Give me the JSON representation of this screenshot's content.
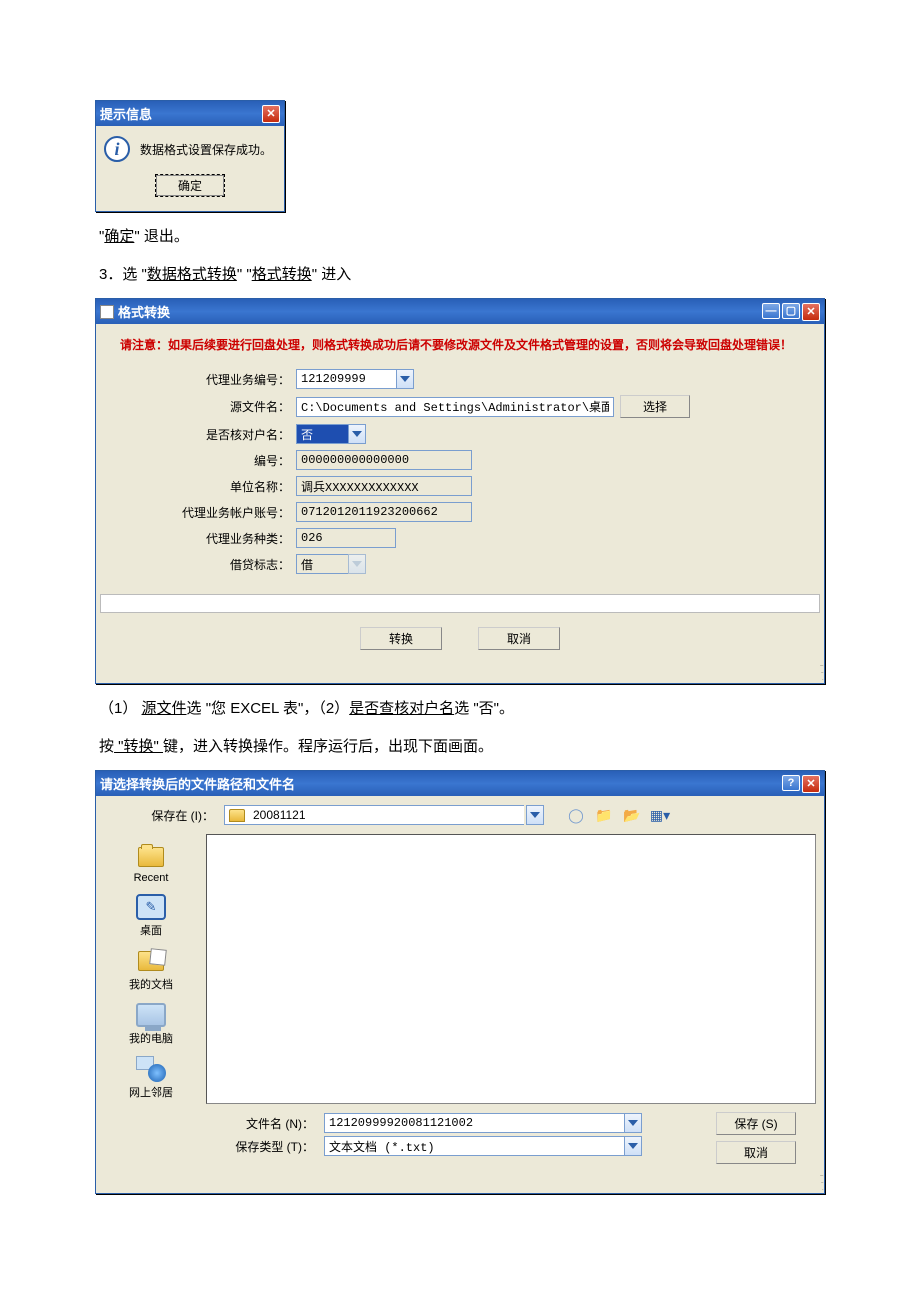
{
  "info_dialog": {
    "title": "提示信息",
    "message": "数据格式设置保存成功。",
    "ok_label": "确定"
  },
  "prose1": {
    "pre": "\"",
    "link": "确定",
    "post": "\" 退出。"
  },
  "step3": {
    "prefix": "3．选 \"",
    "link1": "数据格式转换",
    "mid": "\" \"",
    "link2": "格式转换",
    "suffix": "\" 进入"
  },
  "format_window": {
    "title": "格式转换",
    "notice": "请注意：如果后续要进行回盘处理，则格式转换成功后请不要修改源文件及文件格式管理的设置，否则将会导致回盘处理错误！",
    "fields": {
      "biz_no_label": "代理业务编号：",
      "biz_no": "121209999",
      "src_label": "源文件名：",
      "src_value": "C:\\Documents and Settings\\Administrator\\桌面\\工行报盘",
      "choose": "选择",
      "verify_label": "是否核对户名：",
      "verify_value": "否",
      "code_label": "编号：",
      "code_value": "000000000000000",
      "unit_label": "单位名称：",
      "unit_value": "调兵XXXXXXXXXXXXX",
      "acct_label": "代理业务帐户账号：",
      "acct_value": "0712012011923200662",
      "kind_label": "代理业务种类：",
      "kind_value": "026",
      "flag_label": "借贷标志：",
      "flag_value": "借"
    },
    "btn_convert": "转换",
    "btn_cancel": "取消"
  },
  "prose2": {
    "p1_a": "（1）  ",
    "p1_link": "源文件",
    "p1_b": "选 \"您 EXCEL 表\"，（2）",
    "p1_link2": "是否查核对户名",
    "p1_c": "选 \"否\"。"
  },
  "prose3": {
    "a": "按",
    "link": " \"转换\" ",
    "b": "键，进入转换操作。程序运行后，出现下面画面。"
  },
  "save_dialog": {
    "title": "请选择转换后的文件路径和文件名",
    "save_in_label": "保存在 (I)：",
    "save_in_value": "20081121",
    "places": {
      "recent": "Recent",
      "desktop": "桌面",
      "mydocs": "我的文档",
      "mycomp": "我的电脑",
      "network": "网上邻居"
    },
    "filename_label": "文件名 (N)：",
    "filename_value": "12120999920081121002",
    "filetype_label": "保存类型 (T)：",
    "filetype_value": "文本文档 (*.txt)",
    "btn_save": "保存 (S)",
    "btn_cancel": "取消"
  }
}
